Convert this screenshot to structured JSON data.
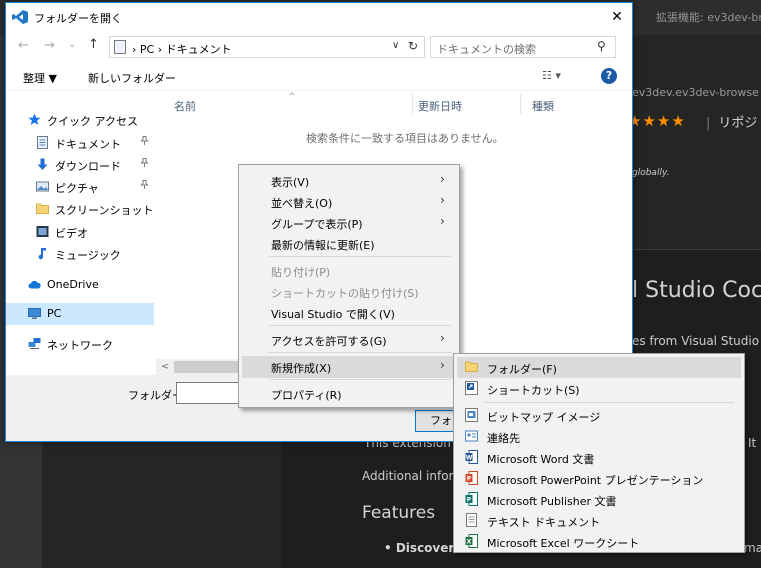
{
  "vscode": {
    "tab_label": "拡張機能: ev3dev-br",
    "ext_id": "ev3dev.ev3dev-browse",
    "stars": "★★★★",
    "repo_label": "リポジト",
    "globally_text": "globally.",
    "title_fragment": "l Studio Coc",
    "desc_fragment": "es from Visual Studio Co",
    "ext_note": "This extension is",
    "it_fragment": "It",
    "additional_info": "Additional inform",
    "features_heading": "Features",
    "bullet_item": "• Discover",
    "bullet_tail": "ma"
  },
  "dialog": {
    "title": "フォルダーを開く",
    "close_glyph": "✕",
    "nav": {
      "back": "←",
      "forward": "→",
      "dropdown": "⌄",
      "up": "↑"
    },
    "address_path": "›  PC  ›  ドキュメント",
    "address_dropdown": "∨",
    "refresh": "↻",
    "search_placeholder": "ドキュメントの検索",
    "search_icon": "⚲",
    "toolbar": {
      "organize": "整理 ▼",
      "new_folder": "新しいフォルダー",
      "view": "☷ ▾",
      "help": "?"
    },
    "left_pane": [
      {
        "label": "クイック アクセス",
        "icon": "star-icon",
        "pinned": false,
        "top": true
      },
      {
        "label": "ドキュメント",
        "icon": "documents-icon",
        "pinned": true
      },
      {
        "label": "ダウンロード",
        "icon": "download-icon",
        "pinned": true
      },
      {
        "label": "ピクチャ",
        "icon": "pictures-icon",
        "pinned": true
      },
      {
        "label": "スクリーンショット",
        "icon": "folder-icon",
        "pinned": false
      },
      {
        "label": "ビデオ",
        "icon": "video-icon",
        "pinned": false
      },
      {
        "label": "ミュージック",
        "icon": "music-icon",
        "pinned": false
      },
      {
        "label": "OneDrive",
        "icon": "onedrive-icon",
        "pinned": false,
        "top": true
      },
      {
        "label": "PC",
        "icon": "pc-icon",
        "pinned": false,
        "top": true,
        "selected": true
      },
      {
        "label": "ネットワーク",
        "icon": "network-icon",
        "pinned": false,
        "top": true
      }
    ],
    "pin_glyph": "📌",
    "columns": [
      "名前",
      "更新日時",
      "種類"
    ],
    "sort_glyph": "^",
    "empty_message": "検索条件に一致する項目はありません。",
    "scroll_left": "<",
    "folder_label": "フォルダー:",
    "folder_value": "",
    "select_button": "フォルダーの選択"
  },
  "context_menu": {
    "items": [
      {
        "label": "表示(V)",
        "submenu": true
      },
      {
        "label": "並べ替え(O)",
        "submenu": true
      },
      {
        "label": "グループで表示(P)",
        "submenu": true
      },
      {
        "label": "最新の情報に更新(E)",
        "submenu": false
      },
      {
        "label": "貼り付け(P)",
        "disabled": true
      },
      {
        "label": "ショートカットの貼り付け(S)",
        "disabled": true
      },
      {
        "label": "Visual Studio で開く(V)"
      },
      {
        "label": "アクセスを許可する(G)",
        "submenu": true
      },
      {
        "label": "新規作成(X)",
        "submenu": true,
        "highlighted": true
      },
      {
        "label": "プロパティ(R)"
      }
    ],
    "arrow_glyph": "›"
  },
  "new_submenu": {
    "items": [
      {
        "label": "フォルダー(F)",
        "icon": "folder-icon",
        "highlighted": true
      },
      {
        "label": "ショートカット(S)",
        "icon": "shortcut-icon"
      },
      {
        "label": "ビットマップ イメージ",
        "icon": "bitmap-icon"
      },
      {
        "label": "連絡先",
        "icon": "contact-icon"
      },
      {
        "label": "Microsoft Word 文書",
        "icon": "word-icon"
      },
      {
        "label": "Microsoft PowerPoint プレゼンテーション",
        "icon": "powerpoint-icon"
      },
      {
        "label": "Microsoft Publisher 文書",
        "icon": "publisher-icon"
      },
      {
        "label": "テキスト ドキュメント",
        "icon": "text-document-icon"
      },
      {
        "label": "Microsoft Excel ワークシート",
        "icon": "excel-icon"
      }
    ]
  },
  "colors": {
    "accent": "#0078d7",
    "selection": "#cce8ff",
    "vscode_bg": "#1e1e1e",
    "star": "#ff8e00"
  }
}
